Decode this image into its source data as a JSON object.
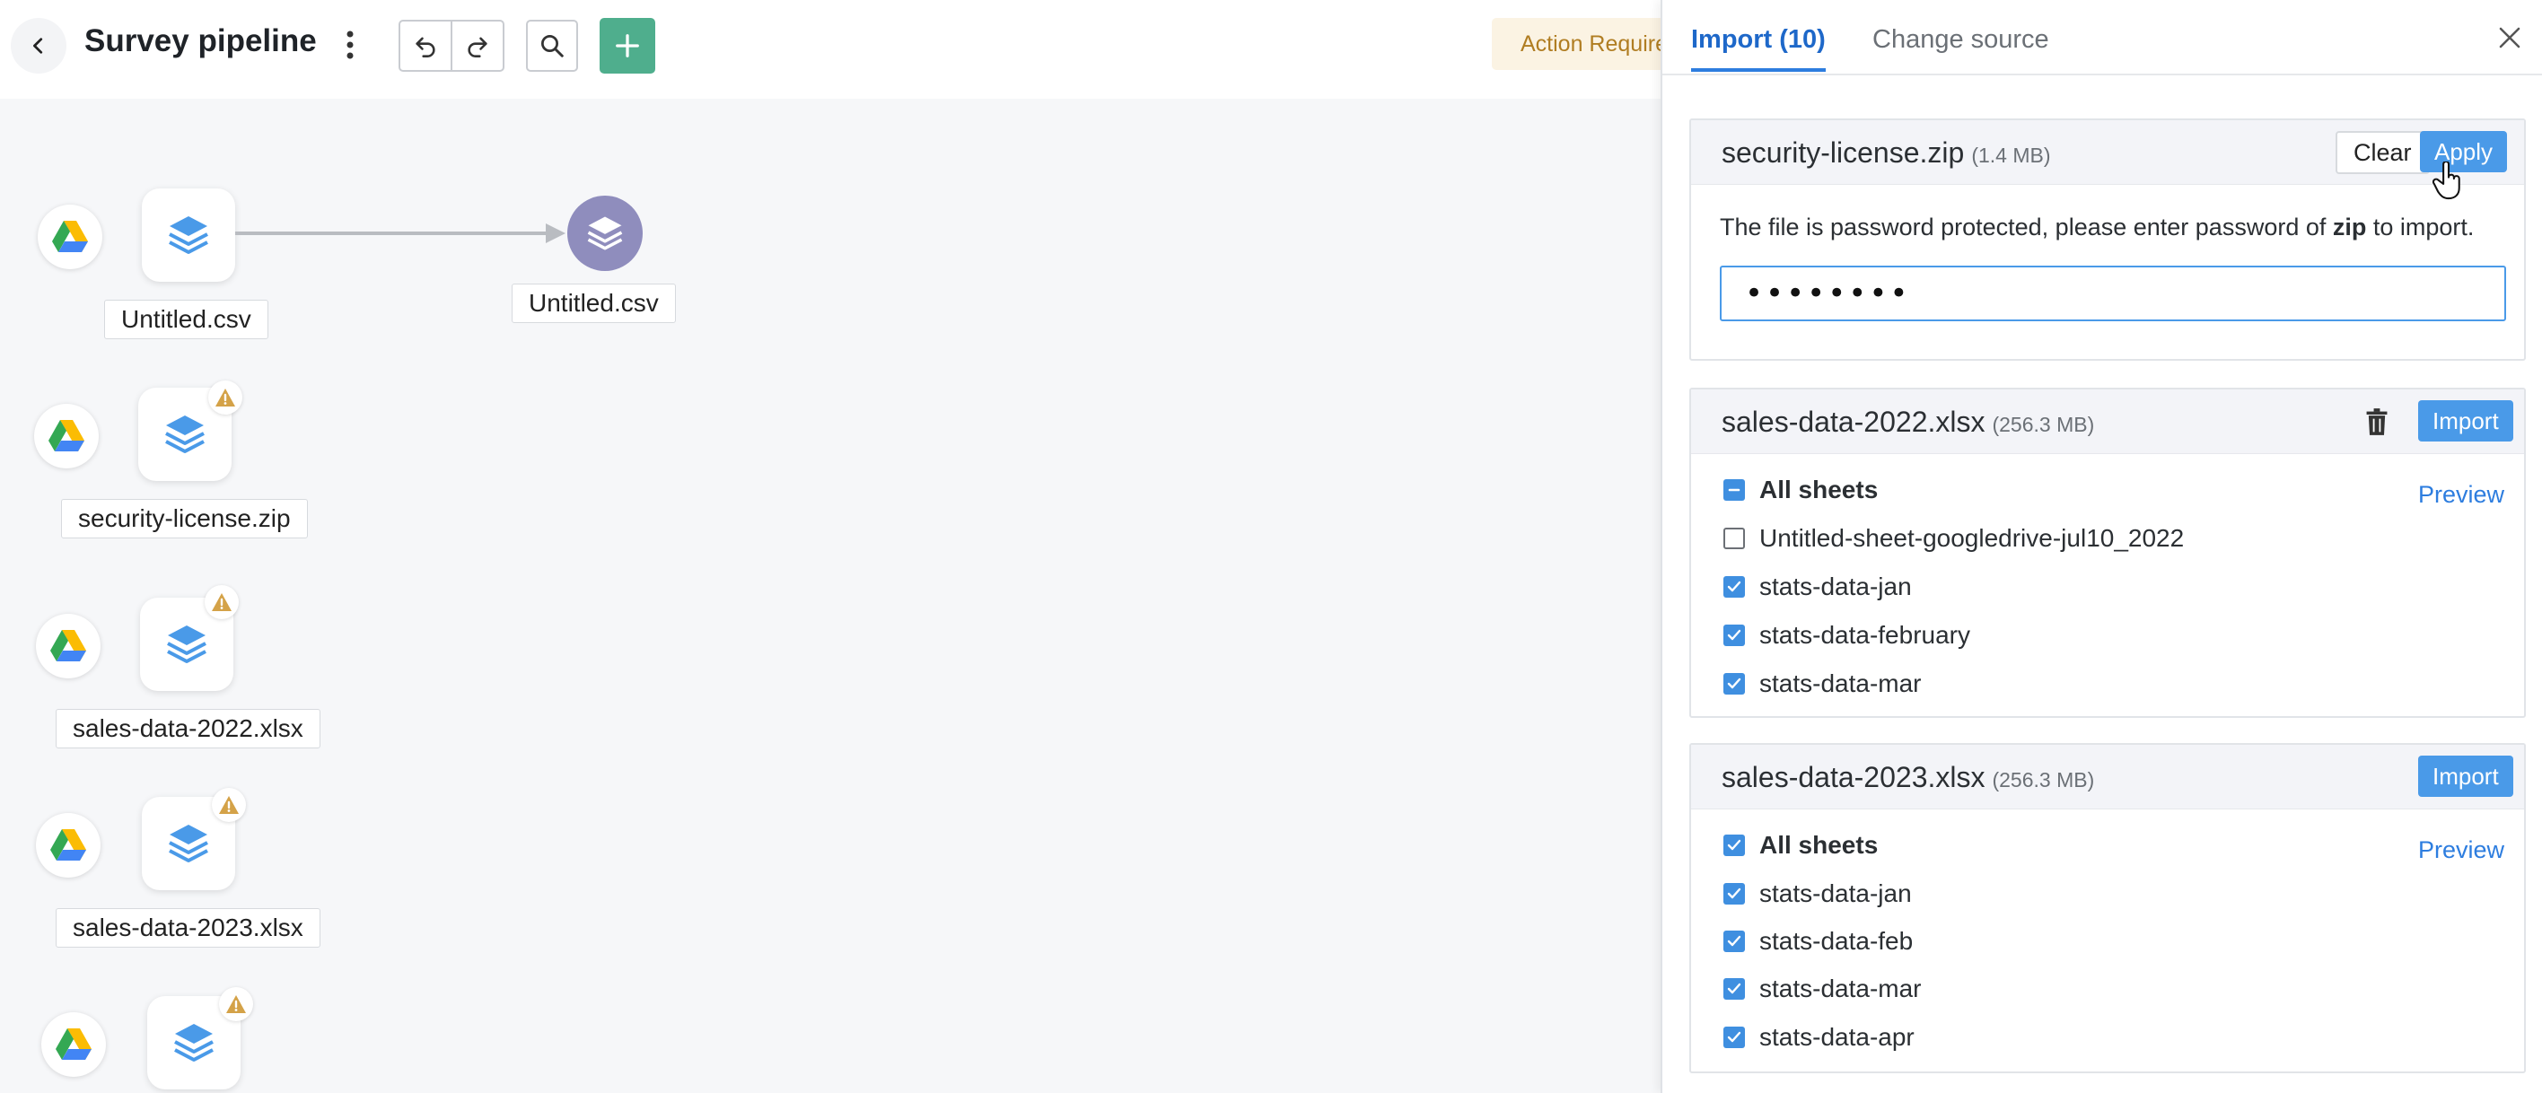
{
  "header": {
    "title": "Survey pipeline",
    "action_badge": "Action Required"
  },
  "canvas": {
    "nodes": [
      {
        "label": "Untitled.csv",
        "warning": false
      },
      {
        "label": "security-license.zip",
        "warning": true
      },
      {
        "label": "sales-data-2022.xlsx",
        "warning": true
      },
      {
        "label": "sales-data-2023.xlsx",
        "warning": true
      },
      {
        "label": "",
        "warning": true
      }
    ],
    "output_node": {
      "label": "Untitled.csv"
    }
  },
  "panel": {
    "tabs": {
      "import": "Import (10)",
      "change_source": "Change source"
    },
    "zip_card": {
      "filename": "security-license.zip",
      "size": "(1.4 MB)",
      "clear_label": "Clear",
      "apply_label": "Apply",
      "message_before": "The file is password protected, please enter password of ",
      "message_bold": "zip",
      "message_after": " to import.",
      "password_value": "••••••••"
    },
    "file_cards": [
      {
        "filename": "sales-data-2022.xlsx",
        "size": "(256.3 MB)",
        "import_label": "Import",
        "preview_label": "Preview",
        "all_sheets_label": "All sheets",
        "all_sheets_state": "partial",
        "sheets": [
          {
            "name": "Untitled-sheet-googledrive-jul10_2022",
            "checked": false
          },
          {
            "name": "stats-data-jan",
            "checked": true
          },
          {
            "name": "stats-data-february",
            "checked": true
          },
          {
            "name": "stats-data-mar",
            "checked": true
          }
        ]
      },
      {
        "filename": "sales-data-2023.xlsx",
        "size": "(256.3 MB)",
        "import_label": "Import",
        "preview_label": "Preview",
        "all_sheets_label": "All sheets",
        "all_sheets_state": "checked",
        "sheets": [
          {
            "name": "stats-data-jan",
            "checked": true
          },
          {
            "name": "stats-data-feb",
            "checked": true
          },
          {
            "name": "stats-data-mar",
            "checked": true
          },
          {
            "name": "stats-data-apr",
            "checked": true
          }
        ]
      }
    ]
  },
  "colors": {
    "accent": "#4a9ae8",
    "add_button": "#4fae8d",
    "output_node": "#8f8dbd",
    "warning": "#d4a248"
  },
  "icons": {
    "back": "chevron-left-icon",
    "more": "more-vertical-icon",
    "undo": "undo-icon",
    "redo": "redo-icon",
    "search": "search-icon",
    "add": "plus-icon",
    "warning": "warning-icon",
    "source": "google-drive-icon",
    "dataset": "layers-icon",
    "close": "close-icon",
    "delete": "trash-icon"
  }
}
